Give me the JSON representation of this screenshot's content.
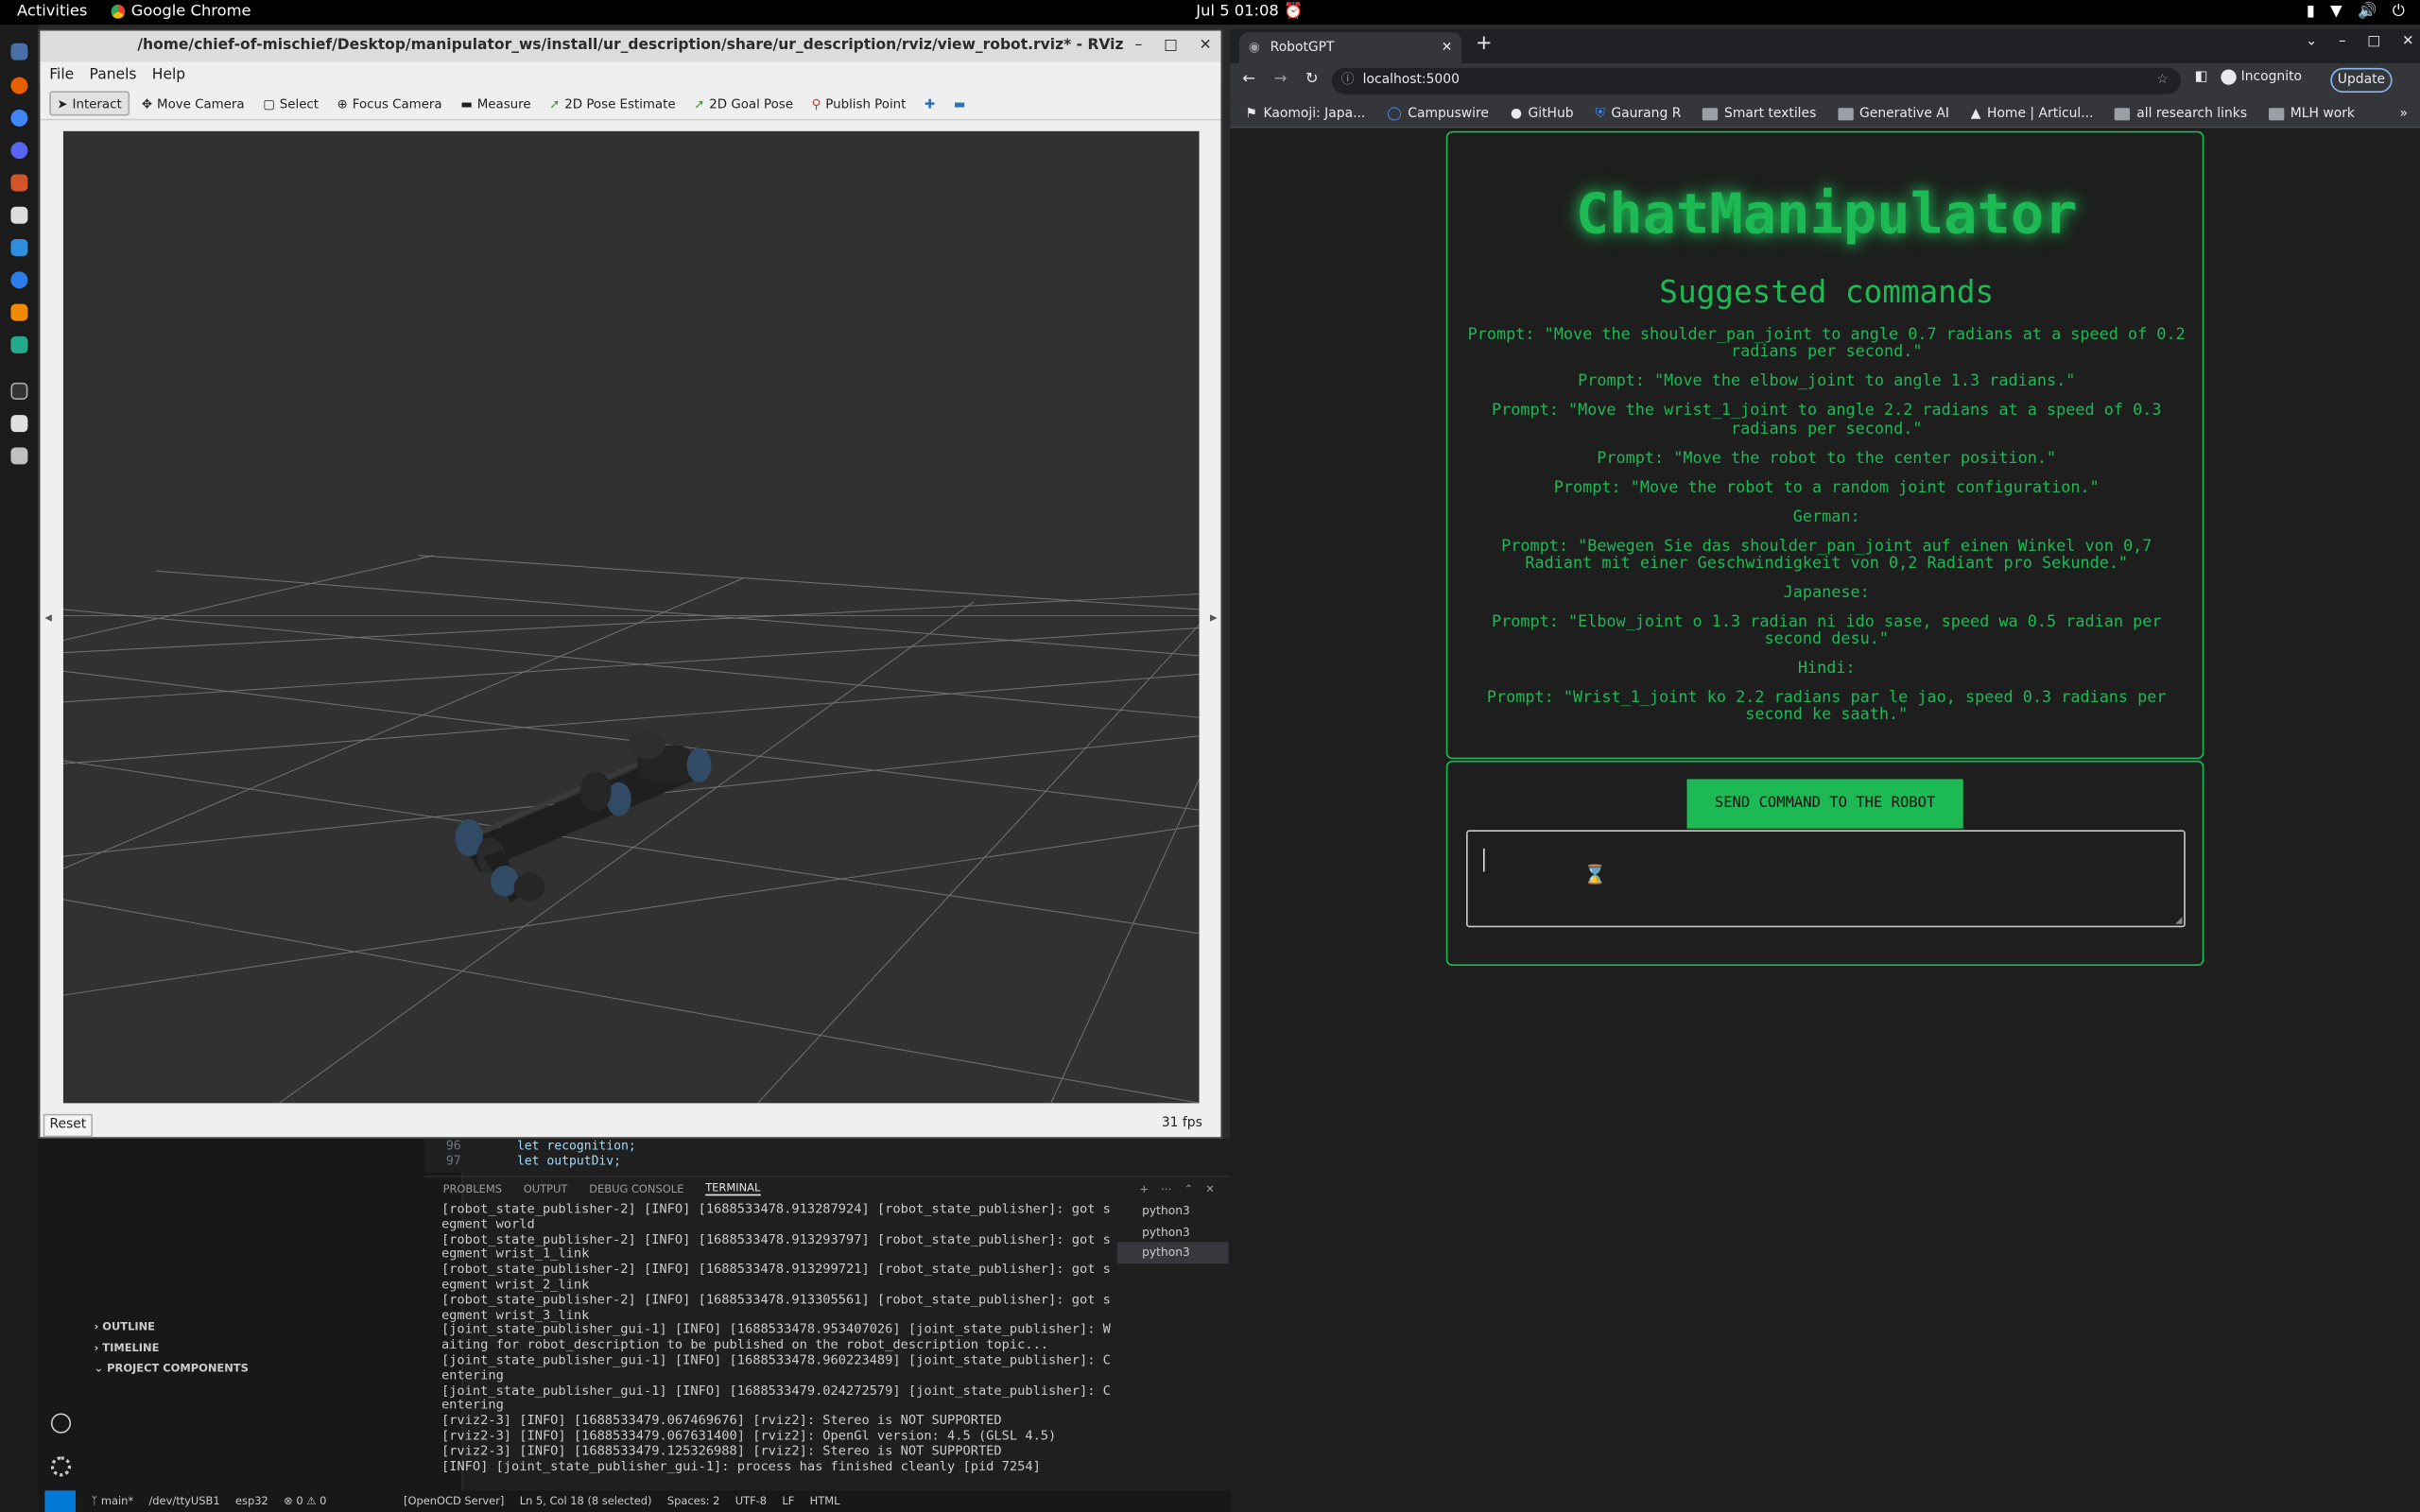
{
  "topbar": {
    "activities": "Activities",
    "app_name": "Google Chrome",
    "clock": "Jul 5  01:08"
  },
  "vscode": {
    "editor_lines": [
      {
        "num": "96",
        "code": "let recognition;"
      },
      {
        "num": "97",
        "code": "let outputDiv;"
      }
    ],
    "panel_tabs": [
      "PROBLEMS",
      "OUTPUT",
      "DEBUG CONSOLE",
      "TERMINAL"
    ],
    "sidebar_sections": [
      "OUTLINE",
      "TIMELINE",
      "PROJECT COMPONENTS"
    ],
    "terminal_lines": [
      "[robot_state_publisher-2] [INFO] [1688533478.913287924] [robot_state_publisher]: got s",
      "egment world",
      "[robot_state_publisher-2] [INFO] [1688533478.913293797] [robot_state_publisher]: got s",
      "egment wrist_1_link",
      "[robot_state_publisher-2] [INFO] [1688533478.913299721] [robot_state_publisher]: got s",
      "egment wrist_2_link",
      "[robot_state_publisher-2] [INFO] [1688533478.913305561] [robot_state_publisher]: got s",
      "egment wrist_3_link",
      "[joint_state_publisher_gui-1] [INFO] [1688533478.953407026] [joint_state_publisher]: W",
      "aiting for robot_description to be published on the robot_description topic...",
      "[joint_state_publisher_gui-1] [INFO] [1688533478.960223489] [joint_state_publisher]: C",
      "entering",
      "[joint_state_publisher_gui-1] [INFO] [1688533479.024272579] [joint_state_publisher]: C",
      "entering",
      "[rviz2-3] [INFO] [1688533479.067469676] [rviz2]: Stereo is NOT SUPPORTED",
      "[rviz2-3] [INFO] [1688533479.067631400] [rviz2]: OpenGl version: 4.5 (GLSL 4.5)",
      "[rviz2-3] [INFO] [1688533479.125326988] [rviz2]: Stereo is NOT SUPPORTED",
      "[INFO] [joint_state_publisher_gui-1]: process has finished cleanly [pid 7254]"
    ],
    "terminal_list": [
      "python3",
      "python3",
      "python3"
    ],
    "status": {
      "branch": "main*",
      "port": "/dev/ttyUSB1",
      "board": "esp32",
      "errors": "0 ⚠ 0",
      "openocd": "[OpenOCD Server]",
      "cursor": "Ln 5, Col 18 (8 selected)",
      "spaces": "Spaces: 2",
      "encoding": "UTF-8",
      "eol": "LF",
      "language": "HTML"
    }
  },
  "rviz": {
    "title": "/home/chief-of-mischief/Desktop/manipulator_ws/install/ur_description/share/ur_description/rviz/view_robot.rviz* - RViz",
    "menu": [
      "File",
      "Panels",
      "Help"
    ],
    "tools": [
      "Interact",
      "Move Camera",
      "Select",
      "Focus Camera",
      "Measure",
      "2D Pose Estimate",
      "2D Goal Pose",
      "Publish Point"
    ],
    "reset_label": "Reset",
    "fps": "31 fps"
  },
  "chrome": {
    "tab_title": "RobotGPT",
    "url": "localhost:5000",
    "incognito_label": "Incognito",
    "update_label": "Update",
    "bookmarks": [
      "Kaomoji: Japa...",
      "Campuswire",
      "GitHub",
      "Gaurang R",
      "Smart textiles",
      "Generative AI",
      "Home | Articul...",
      "all research links",
      "MLH work"
    ]
  },
  "app": {
    "title": "ChatManipulator",
    "suggested_title": "Suggested commands",
    "prompts": [
      "Prompt: \"Move the shoulder_pan_joint to angle 0.7 radians at a speed of 0.2 radians per second.\"",
      "Prompt: \"Move the elbow_joint to angle 1.3 radians.\"",
      "Prompt: \"Move the wrist_1_joint to angle 2.2 radians at a speed of 0.3 radians per second.\"",
      "Prompt: \"Move the robot to the center position.\"",
      "Prompt: \"Move the robot to a random joint configuration.\"",
      "German:",
      "Prompt: \"Bewegen Sie das shoulder_pan_joint auf einen Winkel von 0,7 Radiant mit einer Geschwindigkeit von 0,2 Radiant pro Sekunde.\"",
      "Japanese:",
      "Prompt: \"Elbow_joint o 1.3 radian ni ido sase, speed wa 0.5 radian per second desu.\"",
      "Hindi:",
      "Prompt: \"Wrist_1_joint ko 2.2 radians par le jao, speed 0.3 radians per second ke saath.\""
    ],
    "send_label": "SEND COMMAND TO THE ROBOT",
    "input_value": ""
  },
  "colors": {
    "accent_green": "#1db954",
    "vscode_status_remote": "#0078d4"
  }
}
